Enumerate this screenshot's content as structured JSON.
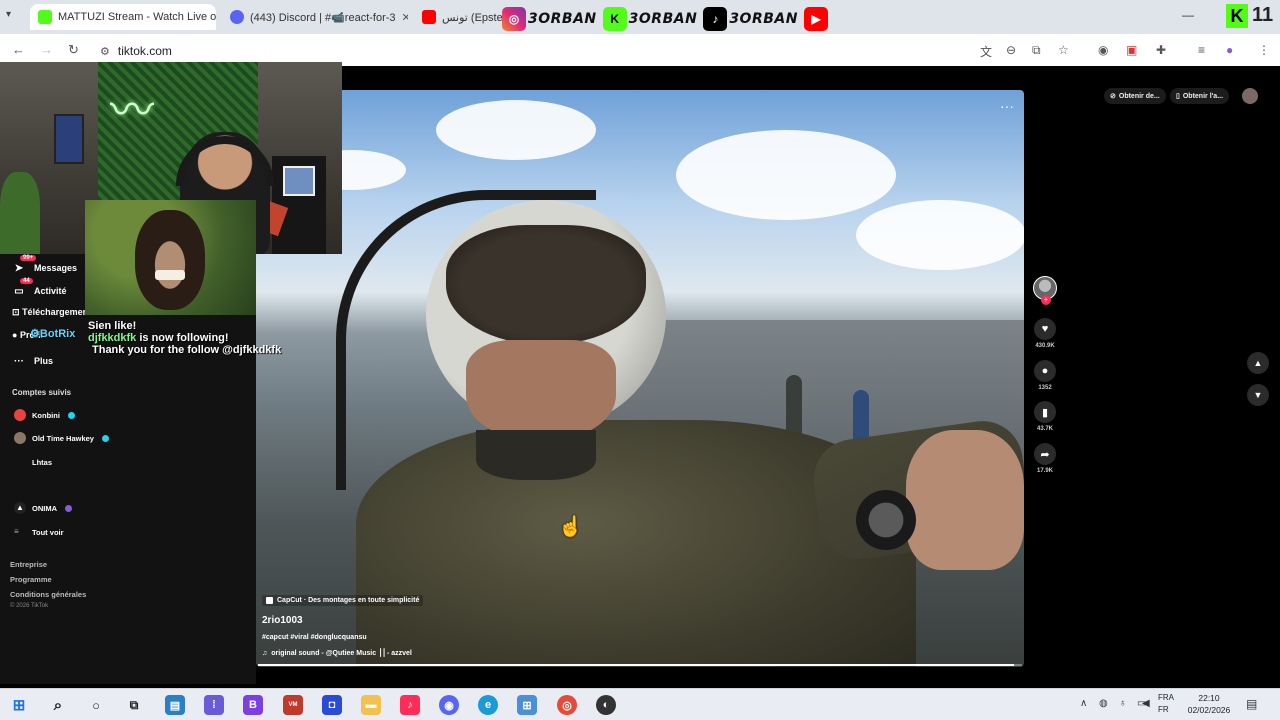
{
  "browser": {
    "tabs": [
      {
        "title": "MATTUZI Stream - Watch Live o",
        "active": true,
        "favicon_color": "#53fc18"
      },
      {
        "title": "(443) Discord | #📹react-for-3",
        "favicon_color": "#5865f2"
      },
      {
        "title": "تونس (Epstein",
        "favicon_color": "#ff0000"
      }
    ],
    "url": "tiktok.com",
    "overlay_name": "3ORBAN",
    "kick_count": "11"
  },
  "sidebar": {
    "nav": [
      {
        "label": "Messages",
        "badge": "99+",
        "icon": "paper-plane-icon"
      },
      {
        "label": "Activité",
        "badge": "44",
        "icon": "bell-icon"
      },
      {
        "label": "Téléchargement",
        "icon": "upload-icon"
      },
      {
        "label": "Profil",
        "icon": "user-icon"
      },
      {
        "label": "Plus",
        "icon": "more-icon"
      }
    ],
    "followed_heading": "Comptes suivis",
    "followed": [
      {
        "name": "Konbini",
        "verified": true
      },
      {
        "name": "Old Time Hawkey",
        "verified": true
      },
      {
        "name": "Lhtas",
        "verified": false
      },
      {
        "name": "ONIMA",
        "verified": true
      }
    ],
    "see_all": "Tout voir",
    "footer": [
      "Entreprise",
      "Programme",
      "Conditions générales"
    ],
    "copyright": "© 2026 TikTok"
  },
  "stream_alert": {
    "line1_prefix": "Sien like!",
    "user": "djfkkdkfk",
    "line1_suffix": " is now following!",
    "bot": "BotRix",
    "line2": "Thank you for the follow @djfkkdkfk"
  },
  "video": {
    "capcut_label": "CapCut · Des montages en toute simplicité",
    "author": "2rio1003",
    "hashtags": "#capcut #viral #donglucquansu",
    "sound": "original sound - @Qutiee Music ⎟⎟ - azzvel",
    "progress": 0.99
  },
  "actions": {
    "likes": "430.9K",
    "comments": "1352",
    "saves": "43.7K",
    "shares": "17.9K"
  },
  "top_right": {
    "button1": "Obtenir de...",
    "button2": "Obtenir l'a..."
  },
  "taskbar": {
    "lang_top": "FRA",
    "lang_bottom": "FR",
    "time": "22:10",
    "date": "02/02/2026"
  }
}
